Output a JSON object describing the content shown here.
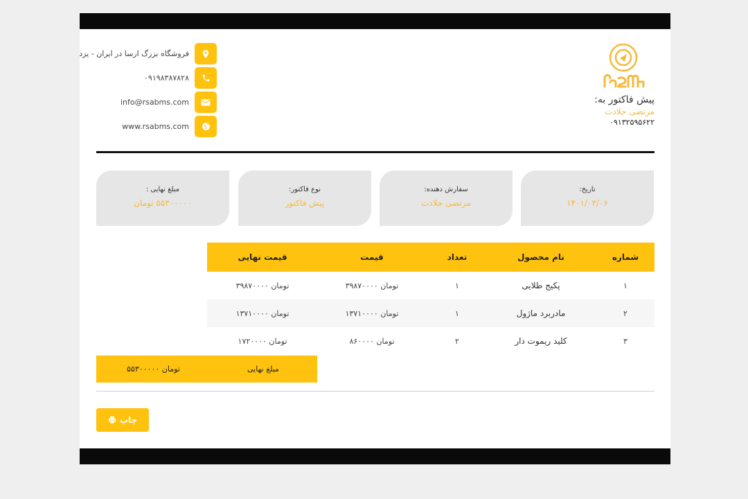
{
  "contacts": [
    {
      "icon": "map-pin-icon",
      "text": "فروشگاه بزرگ ارسا در ایران - یزد"
    },
    {
      "icon": "phone-icon",
      "text": "۰۹۱۹۸۳۸۷۸۲۸"
    },
    {
      "icon": "envelope-icon",
      "text": "info@rsabms.com"
    },
    {
      "icon": "globe-icon",
      "text": "www.rsabms.com"
    }
  ],
  "invoice_to": {
    "label": "پیش فاکتور به:",
    "name": "مرتضی جلادت",
    "phone": "۰۹۱۳۲۵۹۵۶۲۲"
  },
  "info_cards": [
    {
      "label": "تاریخ:",
      "value": "۱۴۰۱/۰۳/۰۶"
    },
    {
      "label": "سفارش دهنده:",
      "value": "مرتضی جلادت"
    },
    {
      "label": "نوع فاکتور:",
      "value": "پیش فاکتور"
    },
    {
      "label": "مبلغ نهایی :",
      "value": "۵۵۳۰۰۰۰۰ تومان"
    }
  ],
  "table": {
    "headers": {
      "number": "شماره",
      "product": "نام محصول",
      "qty": "تعداد",
      "price": "قیمت",
      "final": "قیمت نهایی"
    },
    "rows": [
      {
        "number": "۱",
        "product": "پکیج طلایی",
        "qty": "۱",
        "price": "۳۹۸۷۰۰۰۰ تومان",
        "final": "۳۹۸۷۰۰۰۰ تومان"
      },
      {
        "number": "۲",
        "product": "مادربرد ماژول",
        "qty": "۱",
        "price": "۱۳۷۱۰۰۰۰ تومان",
        "final": "۱۳۷۱۰۰۰۰ تومان"
      },
      {
        "number": "۳",
        "product": "کلید ریموت دار",
        "qty": "۲",
        "price": "۸۶۰۰۰۰ تومان",
        "final": "۱۷۲۰۰۰۰ تومان"
      }
    ]
  },
  "total": {
    "label": "مبلغ نهایی",
    "value": "۵۵۳۰۰۰۰۰ تومان"
  },
  "print_button": {
    "label": "چاپ",
    "icon": "printer-icon"
  },
  "colors": {
    "accent": "#ffc20e",
    "accent_text": "#f6b93b",
    "band": "#0a0a0a",
    "card": "#e6e6e6"
  }
}
